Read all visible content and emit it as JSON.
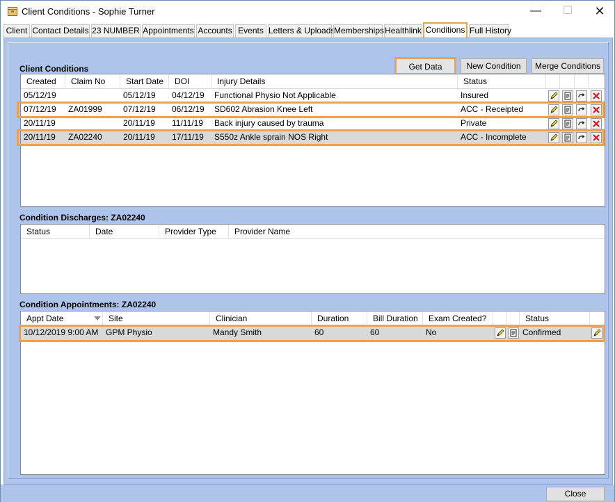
{
  "window": {
    "title": "Client Conditions - Sophie Turner",
    "minimize_glyph": "—",
    "maximize_glyph": "☐",
    "close_glyph": "✕"
  },
  "tabs": [
    {
      "label": "Client",
      "active": false
    },
    {
      "label": "Contact Details",
      "active": false
    },
    {
      "label": "23 NUMBER",
      "active": false
    },
    {
      "label": "Appointments",
      "active": false
    },
    {
      "label": "Accounts",
      "active": false
    },
    {
      "label": "Events",
      "active": false
    },
    {
      "label": "Letters & Uploads",
      "active": false
    },
    {
      "label": "Memberships",
      "active": false
    },
    {
      "label": "Healthlink",
      "active": false
    },
    {
      "label": "Conditions",
      "active": true
    },
    {
      "label": "Full History",
      "active": false
    }
  ],
  "toolbar": {
    "get_data": "Get Data",
    "new_condition": "New Condition",
    "merge_conditions": "Merge Conditions"
  },
  "conditions": {
    "section_title": "Client Conditions",
    "columns": [
      "Created",
      "Claim No",
      "Start Date",
      "DOI",
      "Injury Details",
      "Status"
    ],
    "rows": [
      {
        "created": "05/12/19",
        "claim_no": "",
        "start_date": "05/12/19",
        "doi": "04/12/19",
        "injury_details": "Functional Physio Not Applicable",
        "status": "Insured",
        "highlighted": false,
        "selected": false
      },
      {
        "created": "07/12/19",
        "claim_no": "ZA01999",
        "start_date": "07/12/19",
        "doi": "06/12/19",
        "injury_details": "SD602 Abrasion Knee Left",
        "status": "ACC - Receipted",
        "highlighted": true,
        "selected": false
      },
      {
        "created": "20/11/19",
        "claim_no": "",
        "start_date": "20/11/19",
        "doi": "11/11/19",
        "injury_details": "Back injury caused by trauma",
        "status": "Private",
        "highlighted": false,
        "selected": false
      },
      {
        "created": "20/11/19",
        "claim_no": "ZA02240",
        "start_date": "20/11/19",
        "doi": "17/11/19",
        "injury_details": "S550z Ankle sprain NOS Right",
        "status": "ACC - Incomplete",
        "highlighted": true,
        "selected": true
      }
    ]
  },
  "discharges": {
    "section_title": "Condition Discharges: ZA02240",
    "columns": [
      "Status",
      "Date",
      "Provider Type",
      "Provider Name"
    ]
  },
  "appointments": {
    "section_title": "Condition Appointments: ZA02240",
    "columns": [
      "Appt Date",
      "Site",
      "Clinician",
      "Duration",
      "Bill Duration",
      "Exam Created?",
      "",
      "",
      "Status",
      ""
    ],
    "rows": [
      {
        "appt_date": "10/12/2019 9:00 AM",
        "site": "GPM Physio",
        "clinician": "Mandy Smith",
        "duration": "60",
        "bill_duration": "60",
        "exam_created": "No",
        "status": "Confirmed"
      }
    ]
  },
  "footer": {
    "close": "Close"
  },
  "colors": {
    "panel_bg": "#aec4ea",
    "highlight": "#f0a24b",
    "selected_row": "#d9d9d9",
    "delete_red": "#e0141e"
  },
  "icons": [
    "app-icon",
    "edit-pencil-icon",
    "document-icon",
    "redo-arrow-icon",
    "delete-x-icon",
    "sort-down-icon"
  ]
}
